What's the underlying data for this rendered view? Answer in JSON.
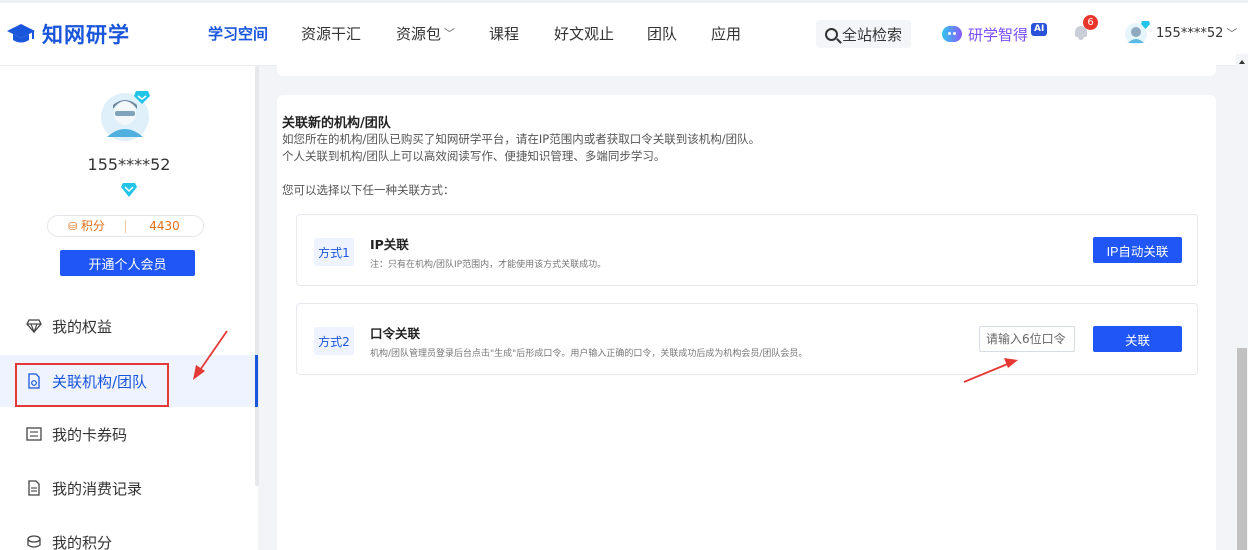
{
  "header": {
    "logo_text": "知网研学",
    "nav": [
      {
        "label": "学习空间",
        "active": true
      },
      {
        "label": "资源干汇",
        "active": false
      },
      {
        "label": "资源包",
        "active": false,
        "dropdown": true
      },
      {
        "label": "课程",
        "active": false
      },
      {
        "label": "好文观止",
        "active": false
      },
      {
        "label": "团队",
        "active": false
      },
      {
        "label": "应用",
        "active": false
      }
    ],
    "search_label": "全站检索",
    "ai_label": "研学智得",
    "ai_badge": "AI",
    "notification_count": "6",
    "username": "155****52"
  },
  "sidebar": {
    "username": "155****52",
    "points_label": "积分",
    "points_value": "4430",
    "open_vip_label": "开通个人会员",
    "menu": [
      {
        "label": "我的权益",
        "icon": "diamond-icon"
      },
      {
        "label": "关联机构/团队",
        "icon": "link-doc-icon",
        "active": true
      },
      {
        "label": "我的卡券码",
        "icon": "ticket-icon"
      },
      {
        "label": "我的消费记录",
        "icon": "document-icon"
      },
      {
        "label": "我的积分",
        "icon": "points-icon"
      }
    ]
  },
  "main": {
    "title": "关联新的机构/团队",
    "desc1": "如您所在的机构/团队已购买了知网研学平台，请在IP范围内或者获取口令关联到该机构/团队。",
    "desc2": "个人关联到机构/团队上可以高效阅读写作、便捷知识管理、多端同步学习。",
    "choose": "您可以选择以下任一种关联方式：",
    "method1": {
      "tag": "方式1",
      "name": "IP关联",
      "note": "注：只有在机构/团队IP范围内，才能使用该方式关联成功。",
      "button": "IP自动关联"
    },
    "method2": {
      "tag": "方式2",
      "name": "口令关联",
      "note": "机构/团队管理员登录后台点击\"生成\"后形成口令。用户输入正确的口令，关联成功后成为机构会员/团队会员。",
      "input_placeholder": "请输入6位口令",
      "button": "关联"
    }
  },
  "colors": {
    "brand": "#1a56db",
    "button": "#1f56f5",
    "points": "#e0711a",
    "highlight_annotation": "#e53935",
    "vip_cyan": "#22c4e8"
  }
}
